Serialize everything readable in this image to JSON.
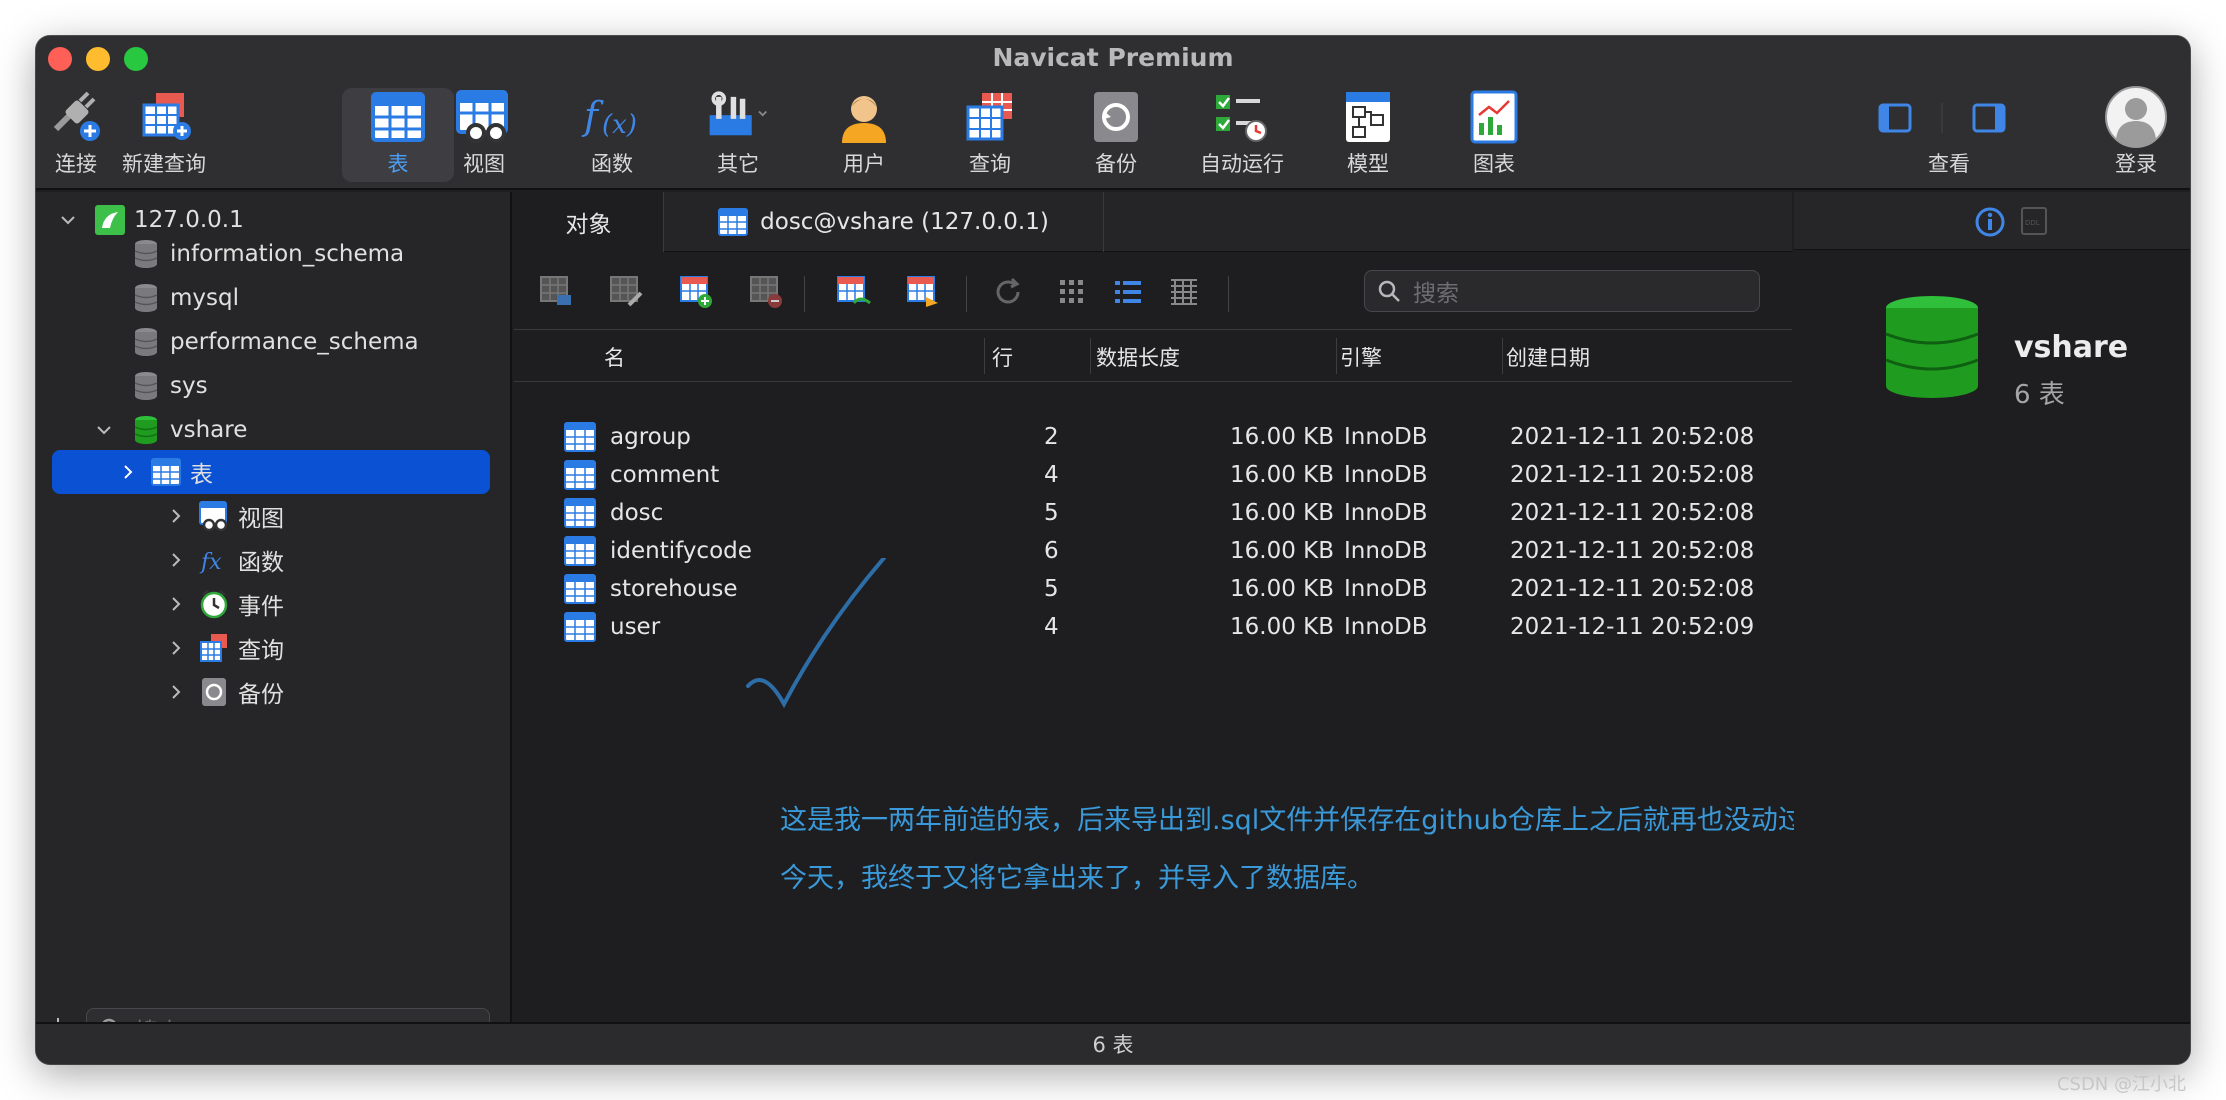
{
  "window": {
    "title": "Navicat Premium"
  },
  "toolbar": {
    "items": [
      {
        "label": "连接"
      },
      {
        "label": "新建查询"
      },
      {
        "label": "表"
      },
      {
        "label": "视图"
      },
      {
        "label": "函数"
      },
      {
        "label": "其它"
      },
      {
        "label": "用户"
      },
      {
        "label": "查询"
      },
      {
        "label": "备份"
      },
      {
        "label": "自动运行"
      },
      {
        "label": "模型"
      },
      {
        "label": "图表"
      },
      {
        "label": "查看"
      },
      {
        "label": "登录"
      }
    ],
    "active": "表"
  },
  "sidebar": {
    "connection": "127.0.0.1",
    "databases": [
      {
        "name": "information_schema"
      },
      {
        "name": "mysql"
      },
      {
        "name": "performance_schema"
      },
      {
        "name": "sys"
      },
      {
        "name": "vshare"
      }
    ],
    "children": [
      {
        "label": "表"
      },
      {
        "label": "视图"
      },
      {
        "label": "函数"
      },
      {
        "label": "事件"
      },
      {
        "label": "查询"
      },
      {
        "label": "备份"
      }
    ],
    "search_placeholder": "搜索"
  },
  "main": {
    "tabs": [
      {
        "label": "对象"
      },
      {
        "label": "dosc@vshare (127.0.0.1)"
      }
    ],
    "search_placeholder": "搜索",
    "columns": [
      {
        "label": "名"
      },
      {
        "label": "行"
      },
      {
        "label": "数据长度"
      },
      {
        "label": "引擎"
      },
      {
        "label": "创建日期"
      }
    ],
    "rows": [
      {
        "name": "agroup",
        "rows": "2",
        "size": "16.00 KB",
        "engine": "InnoDB",
        "created": "2021-12-11 20:52:08"
      },
      {
        "name": "comment",
        "rows": "4",
        "size": "16.00 KB",
        "engine": "InnoDB",
        "created": "2021-12-11 20:52:08"
      },
      {
        "name": "dosc",
        "rows": "5",
        "size": "16.00 KB",
        "engine": "InnoDB",
        "created": "2021-12-11 20:52:08"
      },
      {
        "name": "identifycode",
        "rows": "6",
        "size": "16.00 KB",
        "engine": "InnoDB",
        "created": "2021-12-11 20:52:08"
      },
      {
        "name": "storehouse",
        "rows": "5",
        "size": "16.00 KB",
        "engine": "InnoDB",
        "created": "2021-12-11 20:52:08"
      },
      {
        "name": "user",
        "rows": "4",
        "size": "16.00 KB",
        "engine": "InnoDB",
        "created": "2021-12-11 20:52:09"
      }
    ],
    "note_line1": "这是我一两年前造的表，后来导出到.sql文件并保存在github仓库上之后就再也没动过它。",
    "note_line2": "今天，我终于又将它拿出来了，并导入了数据库。"
  },
  "info_panel": {
    "db_name": "vshare",
    "table_count": "6 表"
  },
  "status_bar": {
    "text": "6 表"
  },
  "watermark": "CSDN @江小北",
  "colors": {
    "accent": "#0a51d4",
    "link_blue": "#4a9ff5",
    "db_green": "#1f9b1f",
    "note_blue": "#3a9ad9"
  }
}
